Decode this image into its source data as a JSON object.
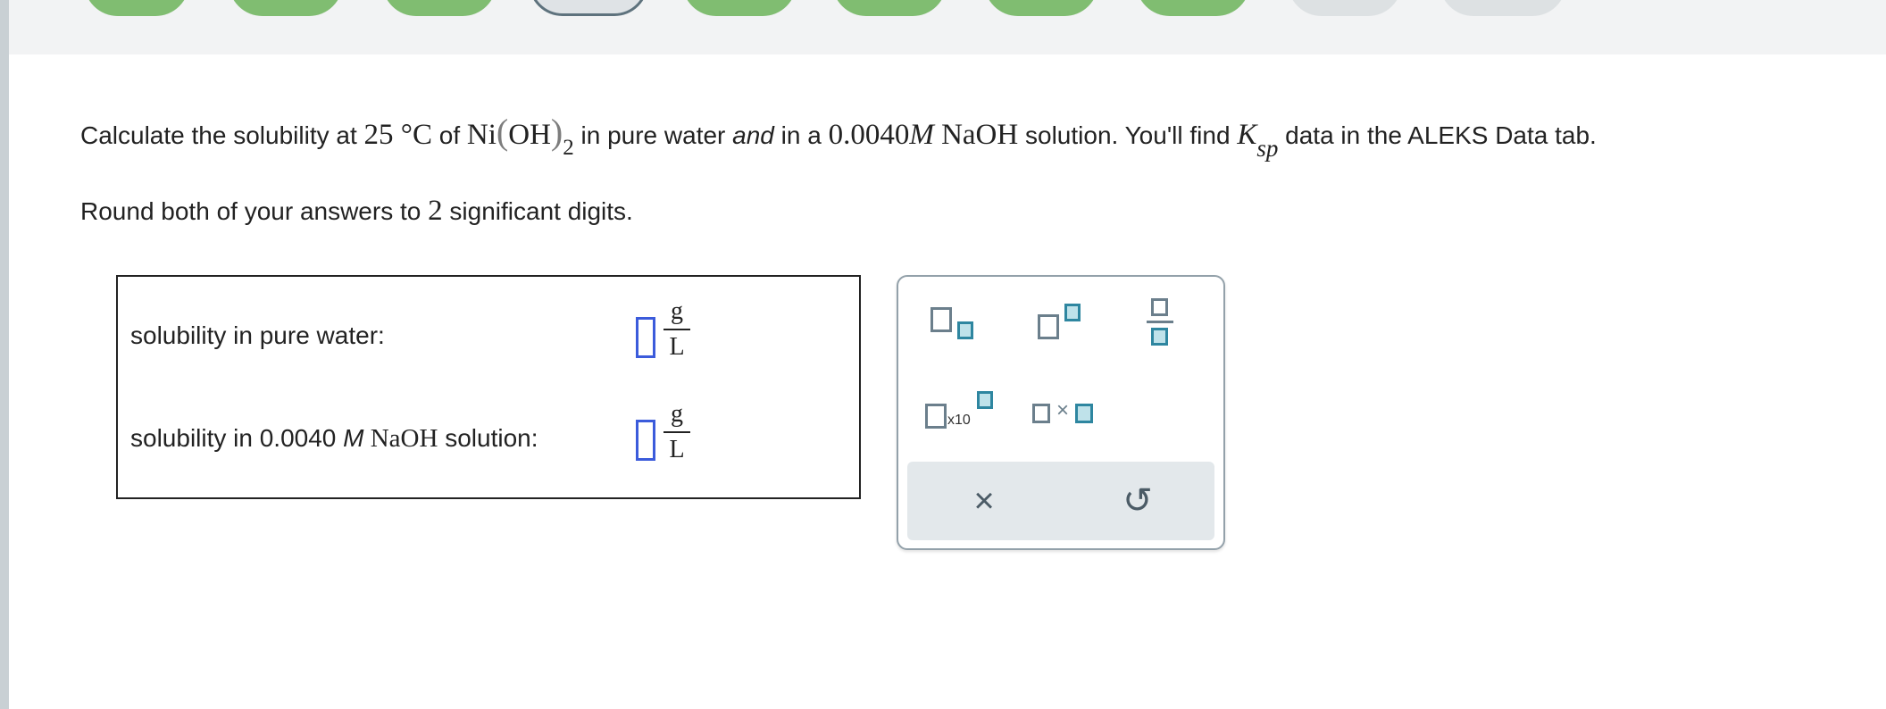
{
  "progress": {
    "steps": [
      {
        "state": "done"
      },
      {
        "state": "done"
      },
      {
        "state": "done"
      },
      {
        "state": "current"
      },
      {
        "state": "done"
      },
      {
        "state": "done"
      },
      {
        "state": "done"
      },
      {
        "state": "done"
      },
      {
        "state": "todo"
      },
      {
        "state": "todo"
      }
    ]
  },
  "question": {
    "t1": "Calculate the solubility at ",
    "temp": "25",
    "deg": " °C",
    "t2": " of ",
    "ni": "Ni",
    "lp": "(",
    "oh": "OH",
    "rp": ")",
    "two": "2",
    "t3": " in pure water ",
    "and": "and",
    "t4": " in a ",
    "conc": "0.0040",
    "m": "M",
    "naoh": " NaOH",
    "t5": " solution. You'll find ",
    "k": "K",
    "sp": "sp",
    "t6": " data in the ALEKS Data tab."
  },
  "rounding": {
    "t1": "Round both of your answers to ",
    "n": "2",
    "t2": " significant digits."
  },
  "answers": {
    "pure_label": "solubility in pure water:",
    "naoh_label_1": "solubility in 0.0040 ",
    "naoh_label_m": "M",
    "naoh_label_2": " NaOH",
    "naoh_label_3": " solution:",
    "unit_num": "g",
    "unit_den": "L"
  },
  "palette": {
    "x10": "x10",
    "times": "×",
    "clear": "×",
    "undo": "↺"
  }
}
